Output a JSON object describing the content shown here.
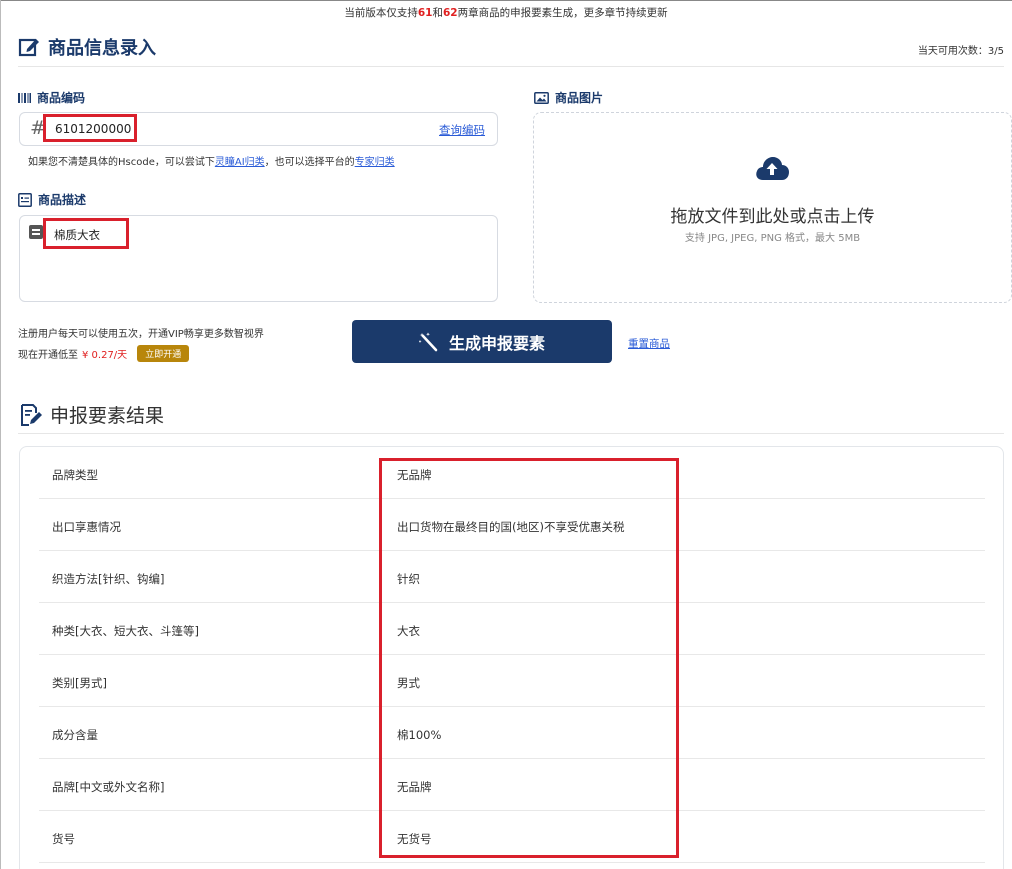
{
  "notice": {
    "prefix": "当前版本仅支持",
    "ch1": "61",
    "mid": "和",
    "ch2": "62",
    "suffix": "两章商品的申报要素生成，更多章节持续更新"
  },
  "header": {
    "title": "商品信息录入",
    "remaining": "当天可用次数：3/5"
  },
  "code_field": {
    "label": "商品编码",
    "hash": "#",
    "value": "6101200000",
    "query_link": "查询编码"
  },
  "hint": {
    "part1": "如果您不清楚具体的Hscode，可以尝试下",
    "link1": "灵瞳AI归类",
    "part2": "，也可以选择平台的",
    "link2": "专家归类"
  },
  "desc_field": {
    "label": "商品描述",
    "value": "棉质大衣"
  },
  "image_field": {
    "label": "商品图片",
    "main": "拖放文件到此处或点击上传",
    "sub": "支持 JPG, JPEG, PNG 格式，最大 5MB"
  },
  "vip": {
    "line1": "注册用户每天可以使用五次，开通VIP畅享更多数智视界",
    "line2_prefix": "现在开通低至",
    "price": "¥ 0.27/天",
    "open_button": "立即开通"
  },
  "actions": {
    "generate": "生成申报要素",
    "reset": "重置商品"
  },
  "results": {
    "title": "申报要素结果",
    "rows": [
      {
        "key": "品牌类型",
        "value": "无品牌"
      },
      {
        "key": "出口享惠情况",
        "value": "出口货物在最终目的国(地区)不享受优惠关税"
      },
      {
        "key": "织造方法[针织、钩编]",
        "value": "针织"
      },
      {
        "key": "种类[大衣、短大衣、斗篷等]",
        "value": "大衣"
      },
      {
        "key": "类别[男式]",
        "value": "男式"
      },
      {
        "key": "成分含量",
        "value": "棉100%"
      },
      {
        "key": "品牌[中文或外文名称]",
        "value": "无品牌"
      },
      {
        "key": "货号",
        "value": "无货号"
      }
    ]
  },
  "colors": {
    "brand": "#1b3a6b",
    "link": "#2a5bd7",
    "price": "#e02020",
    "vip_button": "#b8860b",
    "highlight": "#d9202c"
  }
}
